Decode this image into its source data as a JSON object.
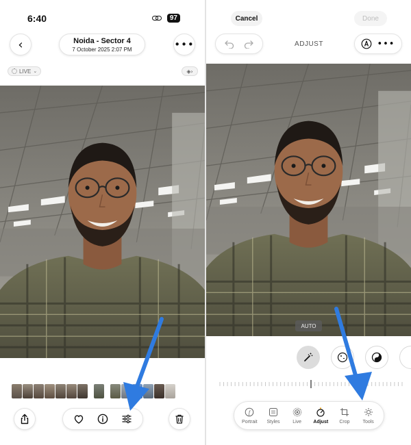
{
  "colors": {
    "accent_arrow": "#2F7BE0",
    "toolbar_bg": "#FFFFFF",
    "photo_shirt": "#6B6B52"
  },
  "left_screen": {
    "status": {
      "time": "6:40",
      "battery": "97"
    },
    "header": {
      "title": "Noida - Sector 4",
      "subtitle": "7 October 2025  2:07 PM"
    },
    "live_badge": "LIVE",
    "toolbar_icons": [
      "share-icon",
      "heart-icon",
      "info-icon",
      "edit-sliders-icon",
      "trash-icon"
    ]
  },
  "right_screen": {
    "cancel_label": "Cancel",
    "done_label": "Done",
    "mode_title": "ADJUST",
    "auto_label": "AUTO",
    "adjust_icons": [
      "magic-wand-icon",
      "exposure-icon",
      "brilliance-icon"
    ],
    "tools": [
      {
        "label": "Portrait",
        "icon": "portrait-icon",
        "active": false
      },
      {
        "label": "Styles",
        "icon": "styles-icon",
        "active": false
      },
      {
        "label": "Live",
        "icon": "live-icon",
        "active": false
      },
      {
        "label": "Adjust",
        "icon": "adjust-icon",
        "active": true
      },
      {
        "label": "Crop",
        "icon": "crop-icon",
        "active": false
      },
      {
        "label": "Tools",
        "icon": "tools-icon",
        "active": false
      }
    ]
  }
}
